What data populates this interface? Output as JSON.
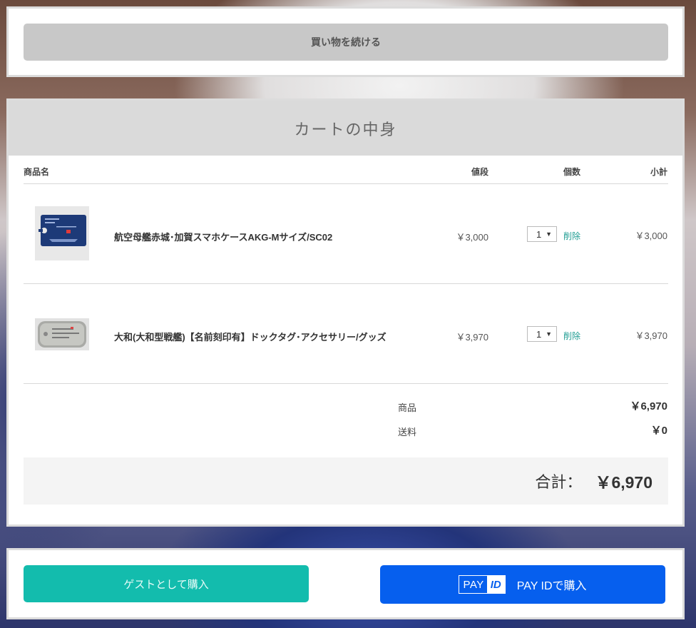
{
  "top": {
    "continue_label": "買い物を続ける"
  },
  "cart": {
    "title": "カートの中身",
    "columns": {
      "name": "商品名",
      "price": "値段",
      "qty": "個数",
      "subtotal": "小計"
    },
    "items": [
      {
        "name": "航空母艦赤城･加賀スマホケースAKG-Mサイズ/SC02",
        "price": "￥3,000",
        "qty": "1",
        "delete_label": "削除",
        "subtotal": "￥3,000",
        "image": "phone-case-thumbnail"
      },
      {
        "name": "大和(大和型戦艦)【名前刻印有】ドックタグ･アクセサリー/グッズ",
        "price": "￥3,970",
        "qty": "1",
        "delete_label": "削除",
        "subtotal": "￥3,970",
        "image": "dog-tag-thumbnail"
      }
    ],
    "summary": {
      "items_label": "商品",
      "items_value": "￥6,970",
      "shipping_label": "送料",
      "shipping_value": "￥0",
      "total_label": "合計：",
      "total_value": "￥6,970"
    }
  },
  "checkout": {
    "guest_label": "ゲストとして購入",
    "payid_logo_pay": "PAY",
    "payid_logo_id": "ID",
    "payid_label": "PAY IDで購入"
  },
  "colors": {
    "guest_button": "#13bcad",
    "payid_button": "#065fee",
    "delete_link": "#1f9d93",
    "header_bg": "#dadada"
  }
}
